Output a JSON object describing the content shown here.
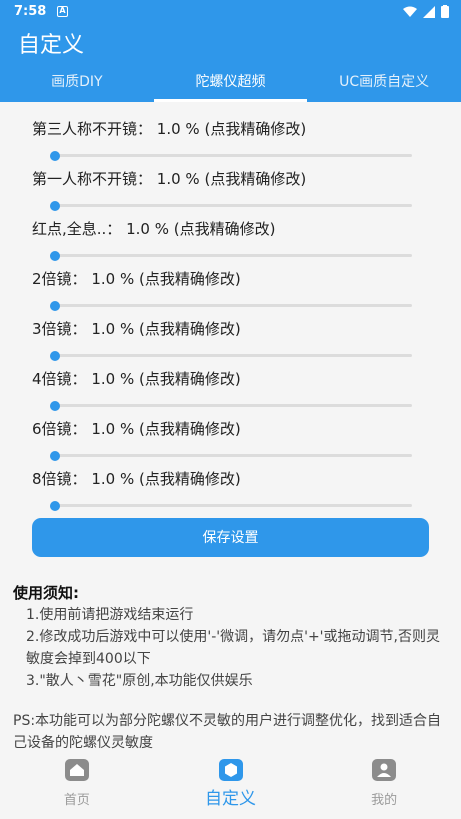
{
  "status": {
    "time": "7:58",
    "notif_glyph": "A"
  },
  "appbar": {
    "title": "自定义"
  },
  "tabs": [
    {
      "label": "画质DIY",
      "active": false
    },
    {
      "label": "陀螺仪超频",
      "active": true
    },
    {
      "label": "UC画质自定义",
      "active": false
    }
  ],
  "sliders": [
    {
      "name": "第三人称不开镜：",
      "value": "1.0 %",
      "hint": "(点我精确修改)",
      "level": 0.01
    },
    {
      "name": "第一人称不开镜：",
      "value": "1.0 %",
      "hint": "(点我精确修改)",
      "level": 0.01
    },
    {
      "name": "红点,全息..：",
      "value": "1.0 %",
      "hint": "(点我精确修改)",
      "level": 0.01
    },
    {
      "name": "2倍镜：",
      "value": "1.0 %",
      "hint": "(点我精确修改)",
      "level": 0.01
    },
    {
      "name": "3倍镜：",
      "value": "1.0 %",
      "hint": "(点我精确修改)",
      "level": 0.01
    },
    {
      "name": "4倍镜：",
      "value": "1.0 %",
      "hint": "(点我精确修改)",
      "level": 0.01
    },
    {
      "name": "6倍镜：",
      "value": "1.0 %",
      "hint": "(点我精确修改)",
      "level": 0.01
    },
    {
      "name": "8倍镜：",
      "value": "1.0 %",
      "hint": "(点我精确修改)",
      "level": 0.01
    }
  ],
  "save_label": "保存设置",
  "notes": {
    "title": "使用须知:",
    "items": [
      "1.使用前请把游戏结束运行",
      "2.修改成功后游戏中可以使用'-'微调，请勿点'+'或拖动调节,否则灵敏度会掉到400以下",
      "3.\"散人丶雪花\"原创,本功能仅供娱乐"
    ],
    "ps": "PS:本功能可以为部分陀螺仪不灵敏的用户进行调整优化，找到适合自己设备的陀螺仪灵敏度"
  },
  "bottom_nav": [
    {
      "label": "首页",
      "icon": "home-icon",
      "active": false
    },
    {
      "label": "自定义",
      "icon": "custom-icon",
      "active": true
    },
    {
      "label": "我的",
      "icon": "profile-icon",
      "active": false
    }
  ],
  "colors": {
    "accent": "#2f97ea"
  }
}
